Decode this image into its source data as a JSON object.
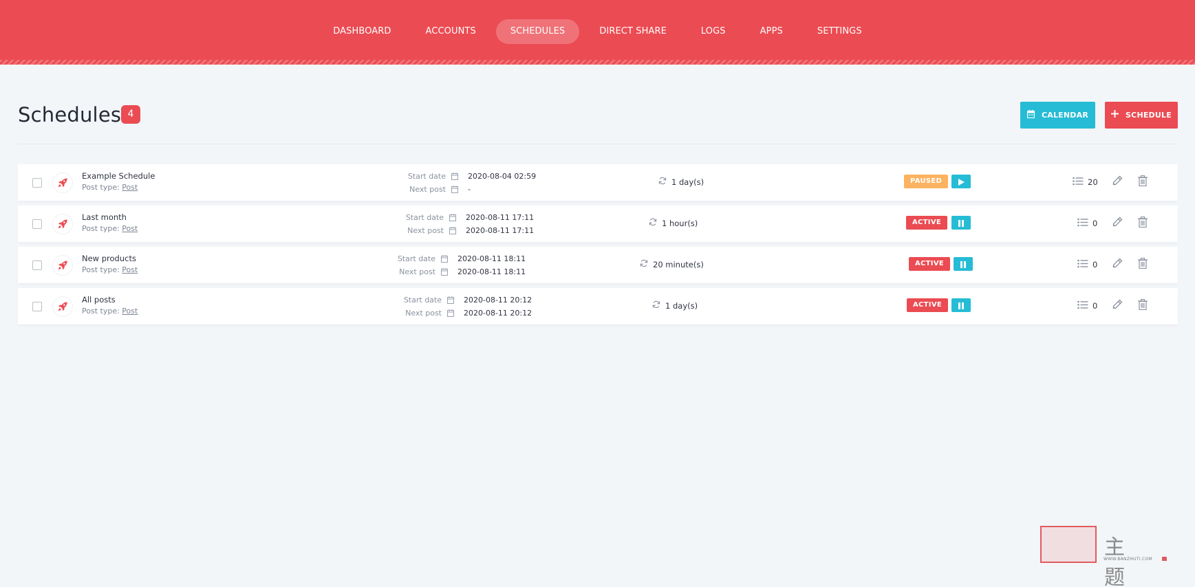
{
  "nav": {
    "items": [
      {
        "label": "DASHBOARD",
        "active": false
      },
      {
        "label": "ACCOUNTS",
        "active": false
      },
      {
        "label": "SCHEDULES",
        "active": true
      },
      {
        "label": "DIRECT SHARE",
        "active": false
      },
      {
        "label": "LOGS",
        "active": false
      },
      {
        "label": "APPS",
        "active": false
      },
      {
        "label": "SETTINGS",
        "active": false
      }
    ]
  },
  "page": {
    "title": "Schedules",
    "count": "4",
    "calendar_label": "CALENDAR",
    "add_label": "SCHEDULE"
  },
  "labels": {
    "post_type": "Post type:",
    "start_date": "Start date",
    "next_post": "Next post"
  },
  "schedules": [
    {
      "name": "Example Schedule",
      "post_type": "Post",
      "start_date": "2020-08-04 02:59",
      "next_post": "-",
      "interval": "1 day(s)",
      "status": "PAUSED",
      "toggle": "play",
      "posts": "20"
    },
    {
      "name": "Last month",
      "post_type": "Post",
      "start_date": "2020-08-11 17:11",
      "next_post": "2020-08-11 17:11",
      "interval": "1 hour(s)",
      "status": "ACTIVE",
      "toggle": "pause",
      "posts": "0"
    },
    {
      "name": "New products",
      "post_type": "Post",
      "start_date": "2020-08-11 18:11",
      "next_post": "2020-08-11 18:11",
      "interval": "20 minute(s)",
      "status": "ACTIVE",
      "toggle": "pause",
      "posts": "0"
    },
    {
      "name": "All posts",
      "post_type": "Post",
      "start_date": "2020-08-11 20:12",
      "next_post": "2020-08-11 20:12",
      "interval": "1 day(s)",
      "status": "ACTIVE",
      "toggle": "pause",
      "posts": "0"
    }
  ],
  "colors": {
    "brand": "#eb4b52",
    "accent": "#26bcd5",
    "paused": "#fcb260",
    "background": "#f3f6f9"
  },
  "icons": {
    "row_avatar": "rocket-icon",
    "date": "calendar-icon",
    "interval": "refresh-icon",
    "posts": "list-icon",
    "edit": "pencil-icon",
    "delete": "trash-icon"
  },
  "watermark": {
    "text": "主题",
    "url": "WWW.BANZHUTI.COM"
  }
}
